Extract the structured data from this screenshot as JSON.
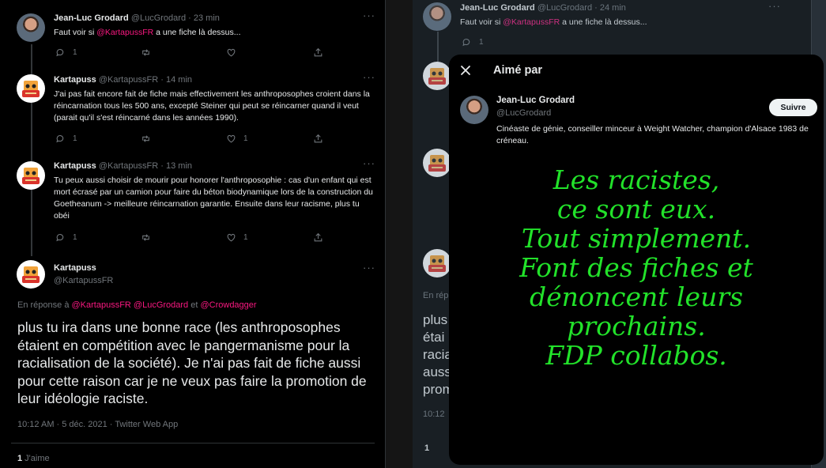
{
  "colors": {
    "background": "#000000",
    "mention": "#f91880",
    "meme_text": "#22e22a",
    "secondary_text": "#71767b"
  },
  "left": {
    "tweets": [
      {
        "name": "Jean-Luc Grodard",
        "handle": "@LucGrodard",
        "time": "· 23 min",
        "text_prefix": "Faut voir si ",
        "mention": "@KartapussFR",
        "text_suffix": " a une fiche là dessus...",
        "reply_count": "1",
        "like_count": ""
      },
      {
        "name": "Kartapuss",
        "handle": "@KartapussFR",
        "time": "· 14 min",
        "text": "J'ai pas fait encore fait de fiche mais effectivement les anthroposophes croient dans la réincarnation tous les 500 ans, excepté Steiner qui peut se réincarner quand il veut (parait qu'il s'est réincarné dans les années 1990).",
        "reply_count": "1",
        "like_count": "1"
      },
      {
        "name": "Kartapuss",
        "handle": "@KartapussFR",
        "time": "· 13 min",
        "text": "Tu peux aussi choisir de mourir pour honorer l'anthroposophie : cas d'un enfant qui est mort écrasé par un camion pour faire du béton biodynamique lors de la construction du Goetheanum -> meilleure réincarnation garantie. Ensuite dans leur racisme, plus tu obéi",
        "reply_count": "1",
        "like_count": "1"
      }
    ],
    "main_tweet": {
      "name": "Kartapuss",
      "handle": "@KartapussFR",
      "reply_prefix": "En réponse à ",
      "reply_mention_1": "@KartapussFR",
      "reply_mention_2": "@LucGrodard",
      "reply_and": " et ",
      "reply_mention_3": "@Crowdagger",
      "text": "plus tu ira dans une bonne race (les anthroposophes étaient en compétition avec le pangermanisme pour la racialisation de la société). Je n'ai pas fait de fiche aussi pour cette raison car je ne veux pas faire la promotion de leur idéologie raciste.",
      "meta": "10:12 AM · 5 déc. 2021 · Twitter Web App",
      "likes_count": "1",
      "likes_label": " J'aime"
    }
  },
  "right": {
    "top_tweet": {
      "name": "Jean-Luc Grodard",
      "handle": "@LucGrodard",
      "time": "· 24 min",
      "text_prefix": "Faut voir si ",
      "mention": "@KartapussFR",
      "text_suffix": " a une fiche là dessus...",
      "reply_count": "1"
    },
    "fragments": {
      "reply_start": "En rép",
      "lines": [
        "plus",
        "étai",
        "racia",
        "aussi",
        "prom"
      ],
      "time": "10:12",
      "likes": "1"
    }
  },
  "modal": {
    "title": "Aimé par",
    "user": {
      "name": "Jean-Luc Grodard",
      "handle": "@LucGrodard",
      "bio": "Cinéaste de génie, conseiller minceur à Weight Watcher, champion d'Alsace 1983 de créneau.",
      "follow_label": "Suivre"
    },
    "meme_lines": [
      "Les racistes,",
      "ce sont eux.",
      "Tout simplement.",
      "Font des fiches et",
      "dénoncent leurs",
      "prochains.",
      "FDP collabos."
    ]
  }
}
